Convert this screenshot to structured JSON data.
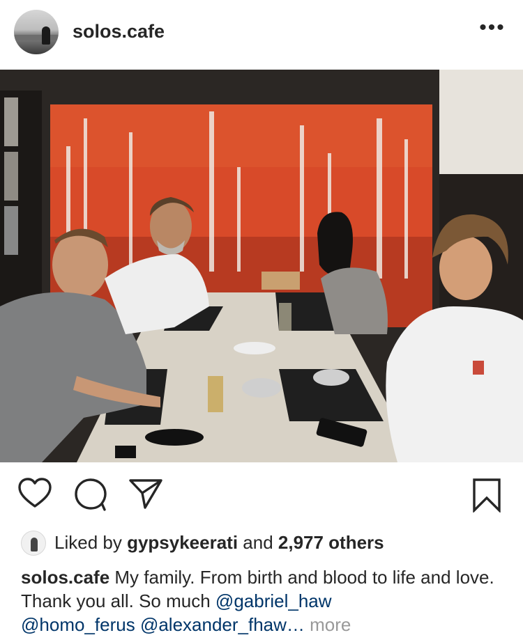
{
  "post": {
    "username": "solos.cafe",
    "more_icon": "more-dots-icon",
    "more_glyph": "•••"
  },
  "actions": {
    "like_icon": "heart-icon",
    "comment_icon": "comment-icon",
    "share_icon": "send-icon",
    "save_icon": "bookmark-icon"
  },
  "likes": {
    "prefix": "Liked by ",
    "user": "gypsykeerati",
    "middle": " and ",
    "count": "2,977 others"
  },
  "caption": {
    "username": "solos.cafe",
    "text": " My family. From birth and blood to life and love. Thank you all. So much ",
    "mention1": "@gabriel_haw",
    "mention2": "@homo_ferus",
    "mention3": "@alexander_fhaw…",
    "more": " more"
  },
  "colors": {
    "text": "#262626",
    "mention": "#003569",
    "muted": "#999999",
    "mural": "#d9492a"
  }
}
